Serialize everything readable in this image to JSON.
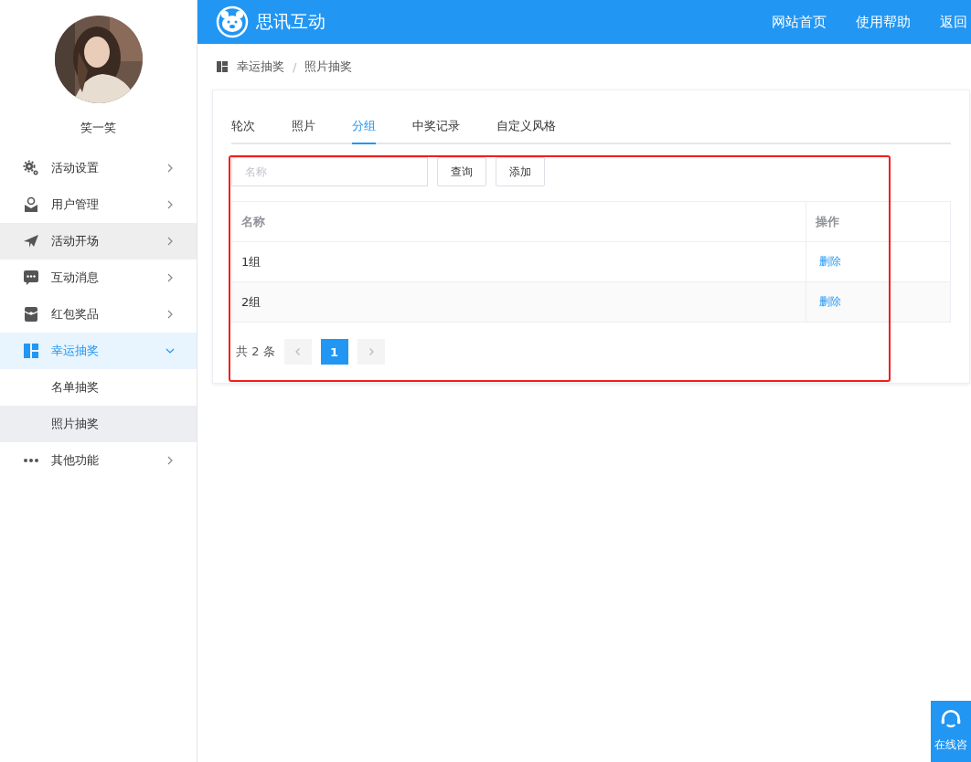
{
  "sidebar": {
    "user_name": "笑一笑",
    "menu": [
      {
        "label": "活动设置",
        "selected": false,
        "hovered": false,
        "expanded": false
      },
      {
        "label": "用户管理",
        "selected": false,
        "hovered": false,
        "expanded": false
      },
      {
        "label": "活动开场",
        "selected": false,
        "hovered": true,
        "expanded": false
      },
      {
        "label": "互动消息",
        "selected": false,
        "hovered": false,
        "expanded": false
      },
      {
        "label": "红包奖品",
        "selected": false,
        "hovered": false,
        "expanded": false
      },
      {
        "label": "幸运抽奖",
        "selected": true,
        "hovered": false,
        "expanded": true,
        "children": [
          {
            "label": "名单抽奖",
            "selected": false
          },
          {
            "label": "照片抽奖",
            "selected": true
          }
        ]
      },
      {
        "label": "其他功能",
        "selected": false,
        "hovered": false,
        "expanded": false
      }
    ]
  },
  "header": {
    "brand": "思讯互动",
    "nav": [
      "网站首页",
      "使用帮助",
      "返回"
    ]
  },
  "breadcrumb": {
    "items": [
      "幸运抽奖",
      "照片抽奖"
    ],
    "separator": "/"
  },
  "tabs": [
    {
      "label": "轮次",
      "selected": false
    },
    {
      "label": "照片",
      "selected": false
    },
    {
      "label": "分组",
      "selected": true
    },
    {
      "label": "中奖记录",
      "selected": false
    },
    {
      "label": "自定义风格",
      "selected": false
    }
  ],
  "search": {
    "placeholder": "名称"
  },
  "buttons": [
    "查询",
    "添加"
  ],
  "table": {
    "columns": [
      "名称",
      "操作"
    ],
    "rows": [
      {
        "name": "1组",
        "action": "删除"
      },
      {
        "name": "2组",
        "action": "删除"
      }
    ]
  },
  "pagination": {
    "total": "共 2 条",
    "pages": [
      {
        "label": "1",
        "selected": true
      }
    ]
  },
  "float_button": {
    "label": "在线咨"
  }
}
